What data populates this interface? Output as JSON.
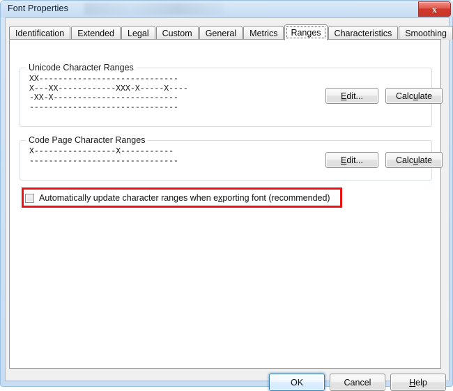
{
  "window": {
    "title": "Font Properties",
    "close_icon": "close-icon",
    "close_glyph": "x"
  },
  "tabs": [
    {
      "label": "Identification",
      "selected": false
    },
    {
      "label": "Extended",
      "selected": false
    },
    {
      "label": "Legal",
      "selected": false
    },
    {
      "label": "Custom",
      "selected": false
    },
    {
      "label": "General",
      "selected": false
    },
    {
      "label": "Metrics",
      "selected": false
    },
    {
      "label": "Ranges",
      "selected": true
    },
    {
      "label": "Characteristics",
      "selected": false
    },
    {
      "label": "Smoothing",
      "selected": false
    }
  ],
  "unicode_group": {
    "label": "Unicode Character Ranges",
    "ranges_text": "XX-----------------------------\nX---XX------------XXX-X-----X----\n-XX-X--------------------------\n-------------------------------",
    "edit_button": "Edit...",
    "edit_accel": "E",
    "calculate_button": "Calculate",
    "calculate_accel": "u"
  },
  "codepage_group": {
    "label": "Code Page Character Ranges",
    "ranges_text": "X-----------------X-----------\n-------------------------------",
    "edit_button": "Edit...",
    "edit_accel": "E",
    "calculate_button": "Calculate",
    "calculate_accel": "u"
  },
  "auto_update": {
    "label_before": "Automatically update character ranges when e",
    "label_accel": "x",
    "label_after": "porting font (recommended)",
    "checked": false,
    "highlight_color": "#ee1111"
  },
  "footer": {
    "ok": "OK",
    "cancel": "Cancel",
    "help_before": "H",
    "help_accel": "H",
    "help_after": "elp"
  }
}
